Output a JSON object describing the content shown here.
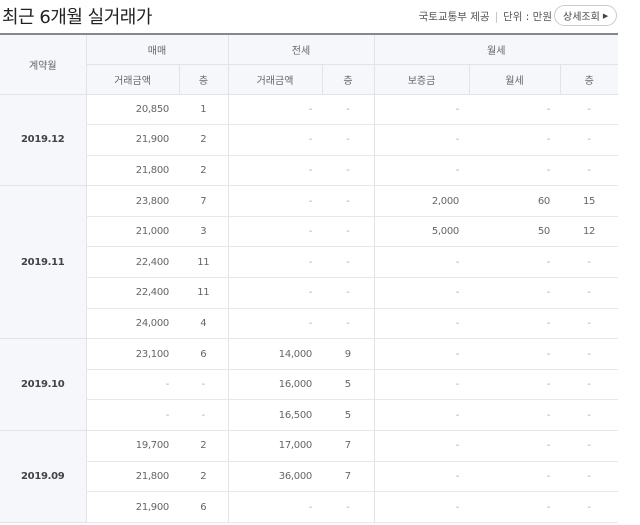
{
  "title": "최근 6개월 실거래가",
  "source": "국토교통부 제공",
  "unit": "단위 : 만원",
  "detail_button": "상세조회",
  "headers": {
    "contract_month": "계약월",
    "sale": "매매",
    "jeonse": "전세",
    "monthly": "월세",
    "sale_price": "거래금액",
    "sale_floor": "층",
    "jeonse_price": "거래금액",
    "jeonse_floor": "층",
    "deposit": "보증금",
    "rent": "월세",
    "monthly_floor": "층"
  },
  "groups": [
    {
      "month": "2019.12",
      "rows": [
        [
          "20,850",
          "1",
          "-",
          "-",
          "-",
          "-",
          "-"
        ],
        [
          "21,900",
          "2",
          "-",
          "-",
          "-",
          "-",
          "-"
        ],
        [
          "21,800",
          "2",
          "-",
          "-",
          "-",
          "-",
          "-"
        ]
      ]
    },
    {
      "month": "2019.11",
      "rows": [
        [
          "23,800",
          "7",
          "-",
          "-",
          "2,000",
          "60",
          "15"
        ],
        [
          "21,000",
          "3",
          "-",
          "-",
          "5,000",
          "50",
          "12"
        ],
        [
          "22,400",
          "11",
          "-",
          "-",
          "-",
          "-",
          "-"
        ],
        [
          "22,400",
          "11",
          "-",
          "-",
          "-",
          "-",
          "-"
        ],
        [
          "24,000",
          "4",
          "-",
          "-",
          "-",
          "-",
          "-"
        ]
      ]
    },
    {
      "month": "2019.10",
      "rows": [
        [
          "23,100",
          "6",
          "14,000",
          "9",
          "-",
          "-",
          "-"
        ],
        [
          "-",
          "-",
          "16,000",
          "5",
          "-",
          "-",
          "-"
        ],
        [
          "-",
          "-",
          "16,500",
          "5",
          "-",
          "-",
          "-"
        ]
      ]
    },
    {
      "month": "2019.09",
      "rows": [
        [
          "19,700",
          "2",
          "17,000",
          "7",
          "-",
          "-",
          "-"
        ],
        [
          "21,800",
          "2",
          "36,000",
          "7",
          "-",
          "-",
          "-"
        ],
        [
          "21,900",
          "6",
          "-",
          "-",
          "-",
          "-",
          "-"
        ]
      ]
    }
  ]
}
